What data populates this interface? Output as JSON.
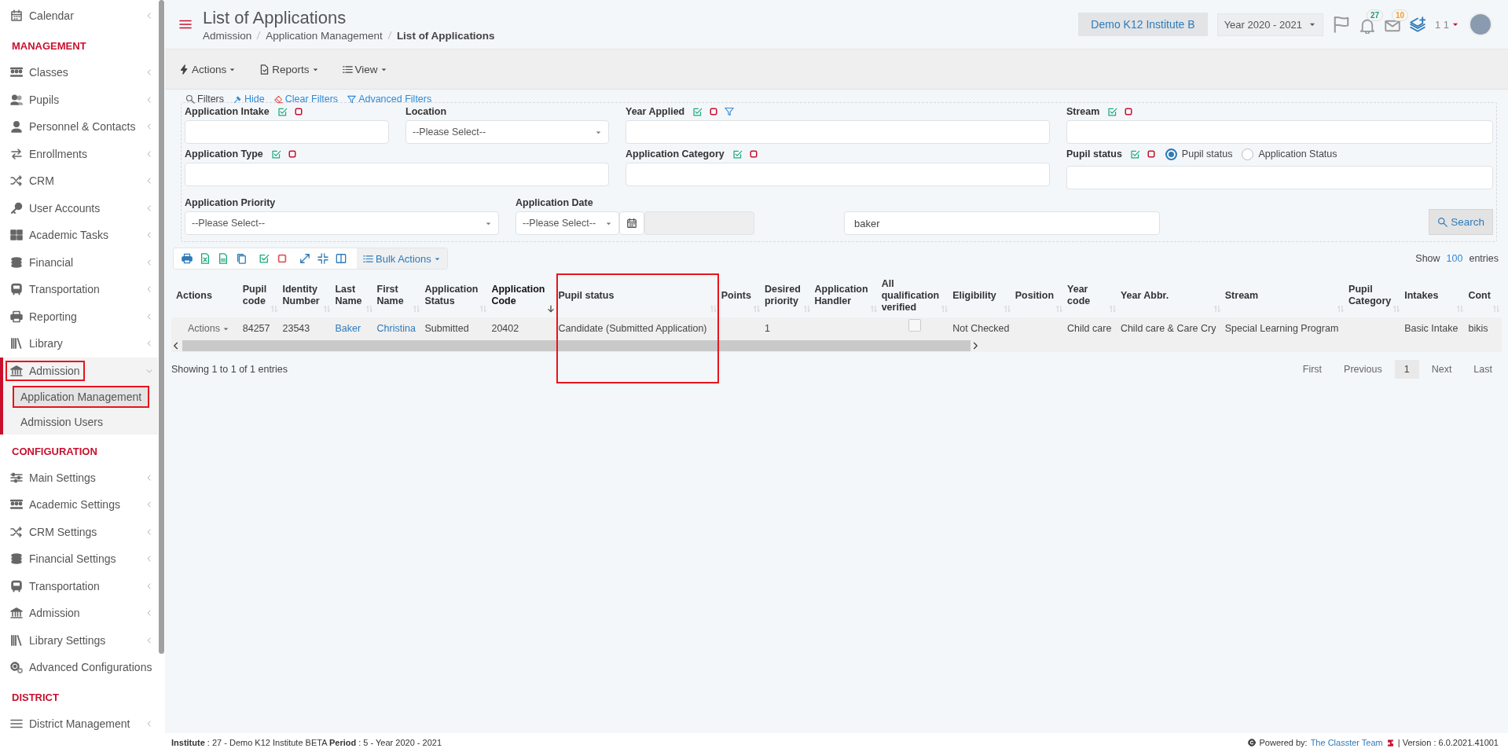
{
  "sidebar": {
    "entries": [
      {
        "kind": "item",
        "label": "Calendar",
        "expanded": false,
        "highlighted": false
      },
      {
        "kind": "heading",
        "label": "MANAGEMENT"
      },
      {
        "kind": "item",
        "label": "Classes",
        "expanded": false,
        "highlighted": false
      },
      {
        "kind": "item",
        "label": "Pupils",
        "expanded": false,
        "highlighted": false
      },
      {
        "kind": "item",
        "label": "Personnel & Contacts",
        "expanded": false,
        "highlighted": false
      },
      {
        "kind": "item",
        "label": "Enrollments",
        "expanded": false,
        "highlighted": false
      },
      {
        "kind": "item",
        "label": "CRM",
        "expanded": false,
        "highlighted": false
      },
      {
        "kind": "item",
        "label": "User Accounts",
        "expanded": false,
        "highlighted": false
      },
      {
        "kind": "item",
        "label": "Academic Tasks",
        "expanded": false,
        "highlighted": false
      },
      {
        "kind": "item",
        "label": "Financial",
        "expanded": false,
        "highlighted": false
      },
      {
        "kind": "item",
        "label": "Transportation",
        "expanded": false,
        "highlighted": false
      },
      {
        "kind": "item",
        "label": "Reporting",
        "expanded": false,
        "highlighted": false
      },
      {
        "kind": "item",
        "label": "Library",
        "expanded": false,
        "highlighted": false
      },
      {
        "kind": "item",
        "label": "Admission",
        "expanded": true,
        "highlighted": true,
        "children": [
          {
            "label": "Application Management",
            "selected": true,
            "highlighted": true
          },
          {
            "label": "Admission Users",
            "selected": false,
            "highlighted": false
          }
        ]
      },
      {
        "kind": "heading",
        "label": "CONFIGURATION"
      },
      {
        "kind": "item",
        "label": "Main Settings",
        "expanded": false,
        "highlighted": false
      },
      {
        "kind": "item",
        "label": "Academic Settings",
        "expanded": false,
        "highlighted": false
      },
      {
        "kind": "item",
        "label": "CRM Settings",
        "expanded": false,
        "highlighted": false
      },
      {
        "kind": "item",
        "label": "Financial Settings",
        "expanded": false,
        "highlighted": false
      },
      {
        "kind": "item",
        "label": "Transportation",
        "expanded": false,
        "highlighted": false
      },
      {
        "kind": "item",
        "label": "Admission",
        "expanded": false,
        "highlighted": false
      },
      {
        "kind": "item",
        "label": "Library Settings",
        "expanded": false,
        "highlighted": false
      },
      {
        "kind": "link",
        "label": "Advanced Configurations"
      },
      {
        "kind": "heading",
        "label": "DISTRICT"
      },
      {
        "kind": "item",
        "label": "District Management",
        "expanded": false,
        "highlighted": false
      }
    ]
  },
  "header": {
    "title": "List of Applications",
    "breadcrumbs": [
      "Admission",
      "Application Management",
      "List of Applications"
    ],
    "institute": "Demo K12 Institute B",
    "year": "Year 2020 - 2021",
    "notifications": [
      {
        "count": "27",
        "color": "#1a9e73"
      },
      {
        "count": "10",
        "color": "#f0a030"
      }
    ],
    "user": "1 1"
  },
  "toolbar": [
    "Actions",
    "Reports",
    "View"
  ],
  "filters": {
    "title": "Filters",
    "links": [
      "Hide",
      "Clear Filters",
      "Advanced Filters"
    ],
    "fields": [
      {
        "kind": "text",
        "label": "Application Intake",
        "toggles": true,
        "filterable": false
      },
      {
        "kind": "select",
        "label": "Location",
        "toggles": false,
        "filterable": false,
        "value": "--Please Select--"
      },
      {
        "kind": "text",
        "label": "Year Applied",
        "toggles": true,
        "filterable": true
      },
      {
        "kind": "text",
        "label": "Stream",
        "toggles": true,
        "filterable": false
      },
      {
        "kind": "text",
        "label": "Application Type",
        "toggles": true,
        "filterable": false
      },
      {
        "kind": "text",
        "label": "Application Category",
        "toggles": true,
        "filterable": false
      },
      {
        "kind": "text",
        "label": "Pupil status",
        "toggles": true,
        "filterable": false,
        "options": [
          {
            "label": "Pupil status",
            "selected": true
          },
          {
            "label": "Application Status",
            "selected": false
          }
        ]
      },
      {
        "kind": "select",
        "label": "Application Priority",
        "toggles": false,
        "filterable": false,
        "value": "--Please Select--"
      },
      {
        "kind": "date",
        "label": "Application Date",
        "toggles": false,
        "filterable": false,
        "value": "--Please Select--"
      },
      {
        "kind": "text",
        "value": "baker"
      }
    ],
    "search_button": "Search"
  },
  "table": {
    "bulk_actions": "Bulk Actions",
    "show": "Show",
    "page_size": "100",
    "entries": "entries",
    "columns": [
      {
        "label": "Actions",
        "sorted": false,
        "highlighted": false
      },
      {
        "label": "Pupil code",
        "sorted": false,
        "highlighted": false
      },
      {
        "label": "Identity Number",
        "sorted": false,
        "highlighted": false
      },
      {
        "label": "Last Name",
        "sorted": false,
        "highlighted": false
      },
      {
        "label": "First Name",
        "sorted": false,
        "highlighted": false
      },
      {
        "label": "Application Status",
        "sorted": false,
        "highlighted": false
      },
      {
        "label": "Application Code",
        "sorted": true,
        "highlighted": false
      },
      {
        "label": "Pupil status",
        "sorted": false,
        "highlighted": true
      },
      {
        "label": "Points",
        "sorted": false,
        "highlighted": false
      },
      {
        "label": "Desired priority",
        "sorted": false,
        "highlighted": false
      },
      {
        "label": "Application Handler",
        "sorted": false,
        "highlighted": false
      },
      {
        "label": "All qualification verified",
        "sorted": false,
        "highlighted": false
      },
      {
        "label": "Eligibility",
        "sorted": false,
        "highlighted": false
      },
      {
        "label": "Position",
        "sorted": false,
        "highlighted": false
      },
      {
        "label": "Year code",
        "sorted": false,
        "highlighted": false
      },
      {
        "label": "Year Abbr.",
        "sorted": false,
        "highlighted": false
      },
      {
        "label": "Stream",
        "sorted": false,
        "highlighted": false
      },
      {
        "label": "Pupil Category",
        "sorted": false,
        "highlighted": false
      },
      {
        "label": "Intakes",
        "sorted": false,
        "highlighted": false
      },
      {
        "label": "Cont",
        "sorted": false,
        "highlighted": false
      }
    ],
    "rows": [
      {
        "cells": [
          {
            "kind": "menu",
            "text": "Actions"
          },
          {
            "kind": "text",
            "text": "84257"
          },
          {
            "kind": "text",
            "text": "23543"
          },
          {
            "kind": "link",
            "text": "Baker"
          },
          {
            "kind": "link",
            "text": "Christina"
          },
          {
            "kind": "text",
            "text": "Submitted"
          },
          {
            "kind": "text",
            "text": "20402"
          },
          {
            "kind": "text",
            "text": "Candidate (Submitted Application)"
          },
          {
            "kind": "blank"
          },
          {
            "kind": "text",
            "text": "1"
          },
          {
            "kind": "blank"
          },
          {
            "kind": "checkbox",
            "checked": false
          },
          {
            "kind": "text",
            "text": "Not Checked"
          },
          {
            "kind": "blank"
          },
          {
            "kind": "text",
            "text": "Child care"
          },
          {
            "kind": "text",
            "text": "Child care & Care Cry"
          },
          {
            "kind": "text",
            "text": "Special Learning Program"
          },
          {
            "kind": "blank"
          },
          {
            "kind": "text",
            "text": "Basic Intake"
          },
          {
            "kind": "text",
            "text": "bikis"
          }
        ]
      }
    ],
    "info": "Showing 1 to 1 of 1 entries",
    "pagination": [
      {
        "label": "First",
        "selected": false
      },
      {
        "label": "Previous",
        "selected": false
      },
      {
        "label": "1",
        "selected": true
      },
      {
        "label": "Next",
        "selected": false
      },
      {
        "label": "Last",
        "selected": false
      }
    ]
  },
  "footer": {
    "info": "**Institute** : 27 - Demo K12 Institute BETA **Period** : 5 - Year 2020 - 2021",
    "powered": "Powered by:",
    "team": "The Classter Team",
    "version": "| Version : 6.0.2021.41001"
  }
}
